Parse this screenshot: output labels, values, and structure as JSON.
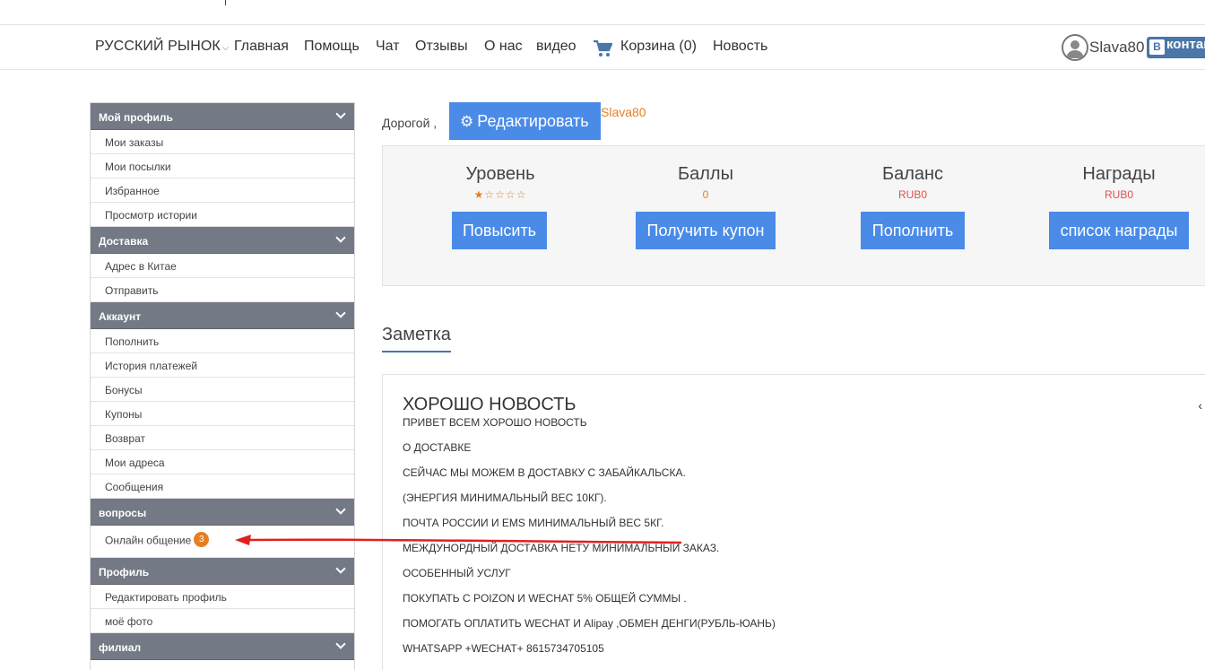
{
  "nav": {
    "brand": "РУССКИЙ РЫНОК",
    "items": [
      "Главная",
      "Помощь",
      "Чат",
      "Отзывы",
      "О нас",
      "видео"
    ],
    "cart": "Корзина (0)",
    "news": "Новость",
    "username": "Slava80",
    "vk_label": "контакте"
  },
  "sidebar": [
    {
      "title": "Мой профиль",
      "items": [
        "Мои заказы",
        "Мои посылки",
        "Избранное",
        "Просмотр истории"
      ]
    },
    {
      "title": "Доставка",
      "items": [
        "Адрес в Китае",
        "Отправить"
      ]
    },
    {
      "title": "Аккаунт",
      "items": [
        "Пополнить",
        "История платежей",
        "Бонусы",
        "Купоны",
        "Возврат",
        "Мои адреса",
        "Сообщения"
      ]
    },
    {
      "title": "вопросы",
      "items": [
        "Онлайн общение"
      ],
      "badge": "3"
    },
    {
      "title": "Профиль",
      "items": [
        "Редактировать профиль",
        "моё фото"
      ]
    },
    {
      "title": "филиал",
      "items": []
    }
  ],
  "profile": {
    "greeting": "Дорогой ,",
    "edit_label": "Редактировать",
    "username": "Slava80"
  },
  "stats": {
    "level": {
      "label": "Уровень",
      "stars_filled": 1,
      "stars_total": 5,
      "button": "Повысить"
    },
    "points": {
      "label": "Баллы",
      "value": "0",
      "button": "Получить купон"
    },
    "balance": {
      "label": "Баланс",
      "value": "RUB0",
      "button": "Пополнить"
    },
    "rewards": {
      "label": "Награды",
      "value": "RUB0",
      "button": "список награды"
    }
  },
  "colors": {
    "accent": "#4a8be8",
    "orange": "#e67e22",
    "red": "#d9534f",
    "sidebar_head": "#737a85",
    "vk": "#4a76a8"
  },
  "note": {
    "section_title": "Заметка",
    "title": "ХОРОШО НОВОСТЬ",
    "lines": [
      "ПРИВЕТ ВСЕМ ХОРОШО НОВОСТЬ",
      "О ДОСТАВКЕ",
      "СЕЙЧАС МЫ МОЖЕМ В ДОСТАВКУ С ЗАБАЙКАЛЬСКА.",
      " (ЭНЕРГИЯ МИНИМАЛЬНЫЙ ВЕС 10КГ).",
      "ПОЧТА РОССИИ  И EMS МИНИМАЛЬНЫЙ ВЕС 5КГ.",
      "МЕЖДУНОРДНЫЙ ДОСТАВКА НЕТУ МИНИМАЛЬНЫЙ ЗАКАЗ.",
      "ОСОБЕННЫЙ УСЛУГ",
      "ПОКУПАТЬ С  POIZON  И  WECHAT 5% ОБЩЕЙ СУММЫ .",
      "ПОМОГАТЬ ОПЛАТИТЬ WECHAT И Alipay ,ОБМЕН ДЕНГИ(РУБЛЬ-ЮАНЬ)",
      "WHATSAPP +WECHAT+ 8615734705105"
    ],
    "prev_glyph": "‹"
  }
}
